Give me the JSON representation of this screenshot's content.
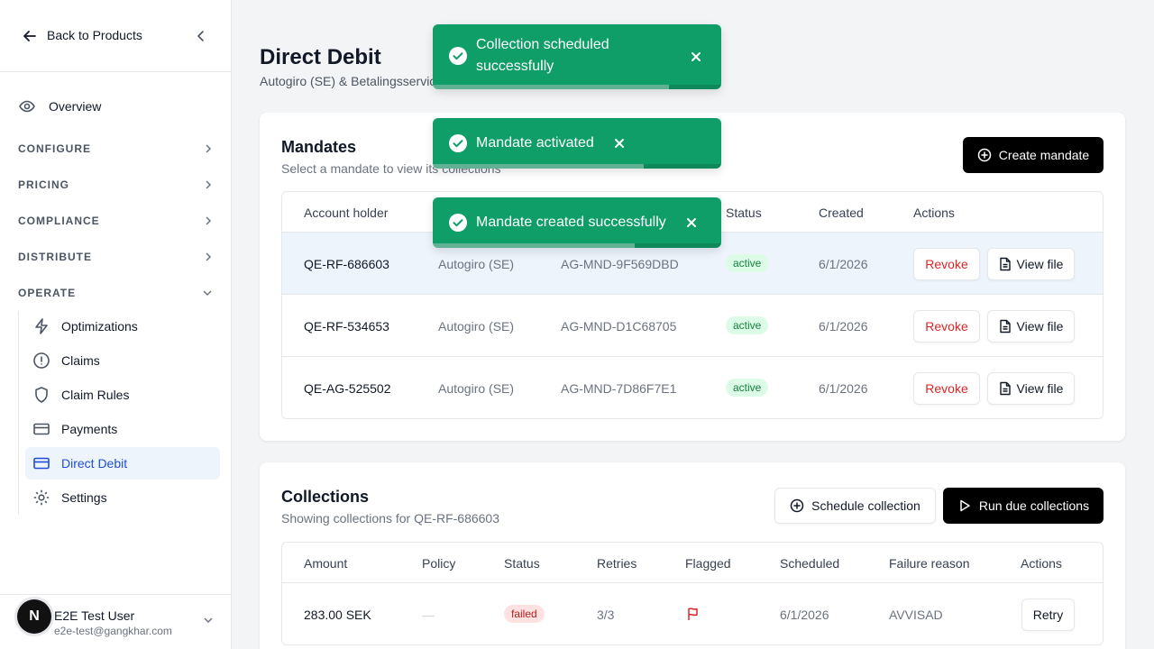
{
  "sidebar": {
    "back_label": "Back to Products",
    "overview_label": "Overview",
    "sections": [
      "CONFIGURE",
      "PRICING",
      "COMPLIANCE",
      "DISTRIBUTE",
      "OPERATE"
    ],
    "operate_items": [
      "Optimizations",
      "Claims",
      "Claim Rules",
      "Payments",
      "Direct Debit",
      "Settings"
    ],
    "active_item": "Direct Debit",
    "user": {
      "initial": "N",
      "name": "E2E Test User",
      "email": "e2e-test@gangkhar.com"
    }
  },
  "page": {
    "title": "Direct Debit",
    "subtitle": "Autogiro (SE) & Betalingsservic"
  },
  "mandates": {
    "title": "Mandates",
    "subtitle": "Select a mandate to view its collections",
    "create_label": "Create mandate",
    "columns": [
      "Account holder",
      "",
      "",
      "Status",
      "Created",
      "Actions"
    ],
    "rows": [
      {
        "holder": "QE-RF-686603",
        "scheme": "Autogiro (SE)",
        "ref": "AG-MND-9F569DBD",
        "status": "active",
        "created": "6/1/2026"
      },
      {
        "holder": "QE-RF-534653",
        "scheme": "Autogiro (SE)",
        "ref": "AG-MND-D1C68705",
        "status": "active",
        "created": "6/1/2026"
      },
      {
        "holder": "QE-AG-525502",
        "scheme": "Autogiro (SE)",
        "ref": "AG-MND-7D86F7E1",
        "status": "active",
        "created": "6/1/2026"
      }
    ],
    "revoke_label": "Revoke",
    "view_label": "View file"
  },
  "collections": {
    "title": "Collections",
    "subtitle": "Showing collections for QE-RF-686603",
    "schedule_label": "Schedule collection",
    "run_label": "Run due collections",
    "columns": [
      "Amount",
      "Policy",
      "Status",
      "Retries",
      "Flagged",
      "Scheduled",
      "Failure reason",
      "Actions"
    ],
    "rows": [
      {
        "amount": "283.00 SEK",
        "policy": "—",
        "status": "failed",
        "retries": "3/3",
        "scheduled": "6/1/2026",
        "reason": "AVVISAD",
        "action": "Retry"
      }
    ]
  },
  "toasts": [
    {
      "line1": "Collection scheduled",
      "line2": "successfully",
      "progress": 0.82
    },
    {
      "line1": "Mandate activated",
      "progress": 0.73
    },
    {
      "line1": "Mandate created successfully",
      "progress": 0.7
    }
  ],
  "colors": {
    "accent": "#1d4ed8",
    "toast": "#0f9d68",
    "danger": "#dc2626",
    "success": "#15803d"
  }
}
